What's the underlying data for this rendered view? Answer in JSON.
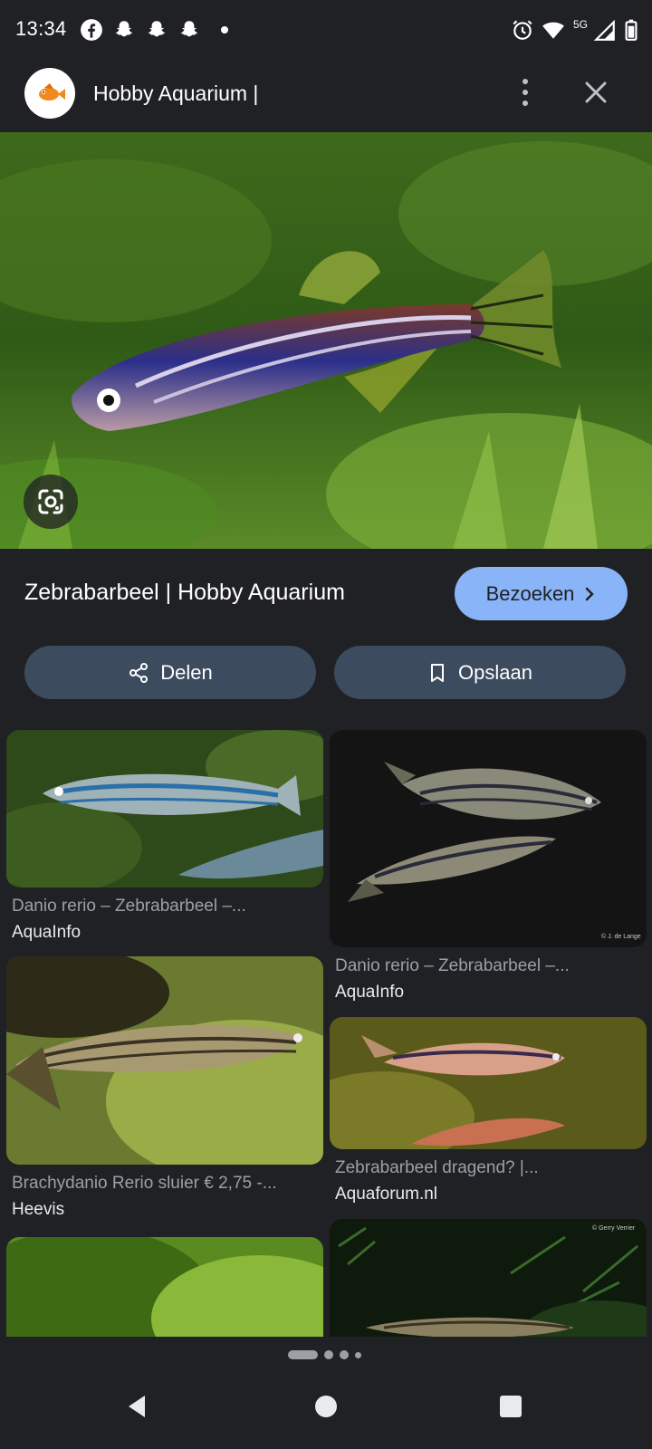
{
  "status_bar": {
    "time": "13:34",
    "network": "5G",
    "left_icons": [
      "facebook-icon",
      "snapchat-icon",
      "snapchat-icon",
      "snapchat-icon",
      "notification-dot"
    ],
    "right_icons": [
      "alarm-icon",
      "wifi-icon",
      "signal-icon",
      "battery-icon"
    ]
  },
  "header": {
    "title": "Hobby Aquarium |",
    "logo_icon": "goldfish-logo",
    "menu_icon": "more-vert-icon",
    "close_icon": "close-icon"
  },
  "hero": {
    "image": "zebrafish-photo",
    "lens_icon": "google-lens-icon"
  },
  "result": {
    "title": "Zebrabarbeel | Hobby Aquarium",
    "visit_label": "Bezoeken",
    "share_label": "Delen",
    "save_label": "Opslaan"
  },
  "related": [
    {
      "caption": "Danio rerio – Zebrabarbeel –...",
      "source": "AquaInfo"
    },
    {
      "caption": "Danio rerio – Zebrabarbeel –...",
      "source": "AquaInfo",
      "credit": "© J. de Lange"
    },
    {
      "caption": "Brachydanio Rerio sluier € 2,75 -...",
      "source": "Heevis"
    },
    {
      "caption": "Zebrabarbeel dragend? |...",
      "source": "Aquaforum.nl"
    },
    {
      "caption": "",
      "source": ""
    },
    {
      "caption": "",
      "source": "",
      "credit": "© Gerry Verrier"
    }
  ],
  "colors": {
    "background": "#202124",
    "accent": "#8ab4f8",
    "chip": "#3c4b5e"
  },
  "pager": {
    "current": 1,
    "total": 4
  },
  "nav": {
    "back": "back-icon",
    "home": "home-icon",
    "recents": "recents-icon"
  }
}
